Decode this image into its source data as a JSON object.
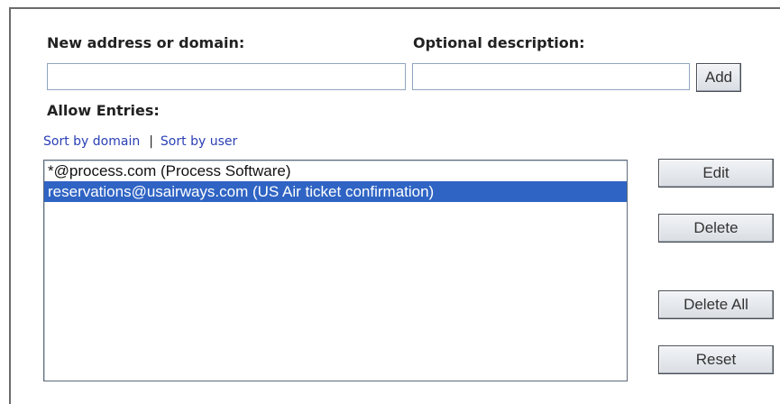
{
  "form": {
    "address_label": "New address or domain:",
    "address_value": "",
    "description_label": "Optional description:",
    "description_value": "",
    "add_button": "Add"
  },
  "allow": {
    "heading": "Allow Entries:",
    "sort_by_domain": "Sort by domain",
    "separator": "|",
    "sort_by_user": "Sort by user",
    "entries": [
      {
        "text": "*@process.com (Process Software)",
        "selected": false
      },
      {
        "text": "reservations@usairways.com (US Air ticket confirmation)",
        "selected": true
      }
    ],
    "selection_color": "#2f64c4"
  },
  "actions": {
    "edit": "Edit",
    "delete": "Delete",
    "delete_all": "Delete All",
    "reset": "Reset"
  }
}
